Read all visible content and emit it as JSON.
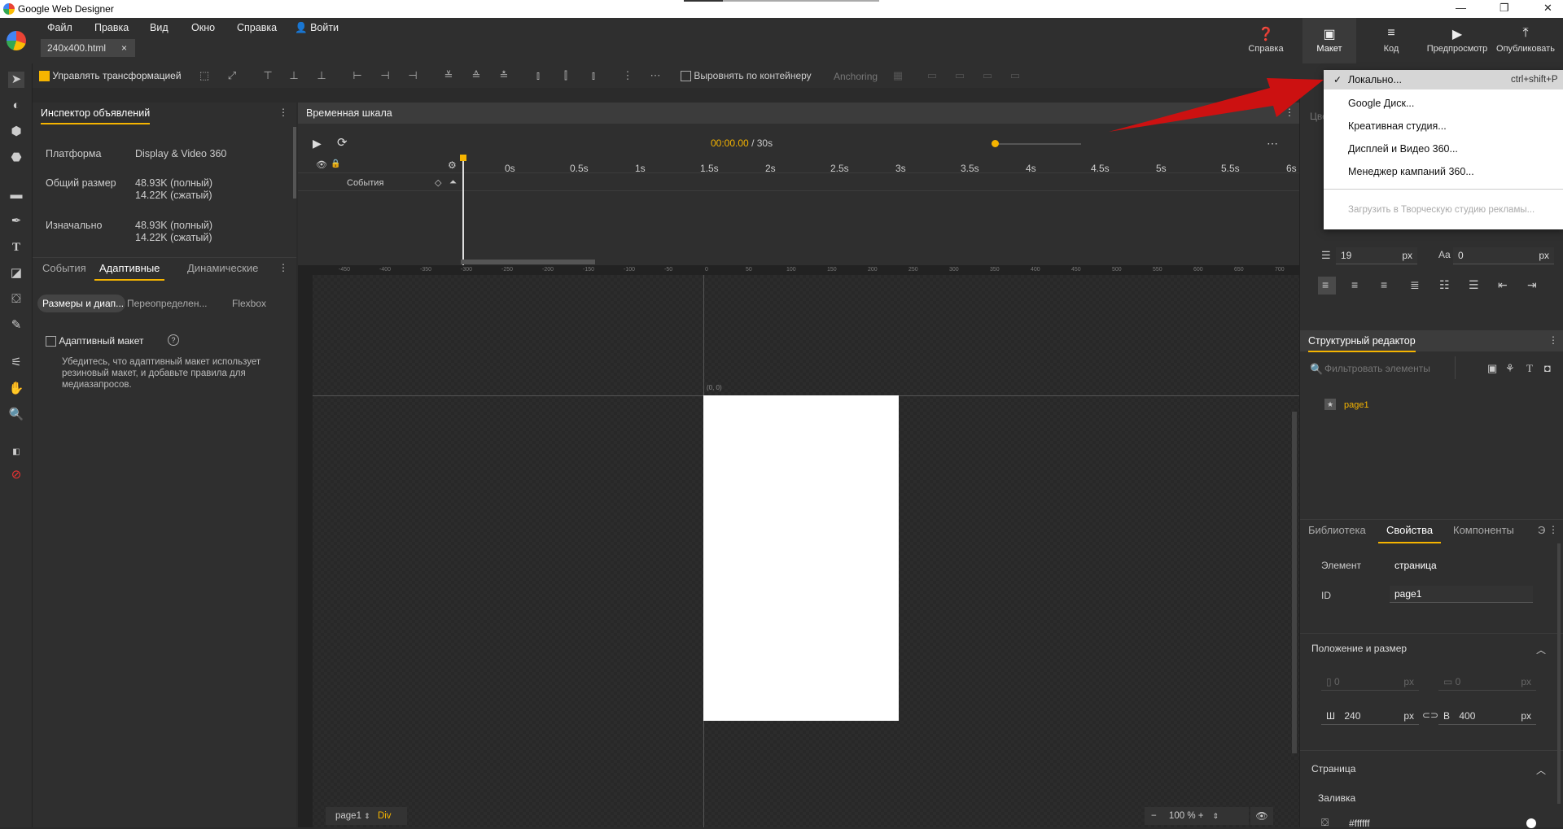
{
  "window": {
    "title": "Google Web Designer"
  },
  "menu": {
    "file": "Файл",
    "edit": "Правка",
    "view": "Вид",
    "window": "Окно",
    "help": "Справка",
    "signin": "Войти"
  },
  "file_tab": {
    "name": "240x400.html",
    "close": "×"
  },
  "top_buttons": {
    "help": "Справка",
    "layout": "Макет",
    "code": "Код",
    "preview": "Предпросмотр",
    "publish": "Опубликовать"
  },
  "toolbar": {
    "manage_transform": "Управлять трансформацией",
    "align_container": "Выровнять по контейнеру",
    "anchoring": "Anchoring"
  },
  "inspector": {
    "title": "Инспектор объявлений",
    "platform_label": "Платформа",
    "platform_value": "Display & Video 360",
    "total_label": "Общий размер",
    "total_full": "48.93K (полный)",
    "total_compressed": "14.22K (сжатый)",
    "initial_label": "Изначально",
    "initial_full": "48.93K (полный)",
    "initial_compressed": "14.22K (сжатый)",
    "tabs": [
      "События",
      "Адаптивные",
      "Динамические"
    ],
    "subtabs": [
      "Размеры и диап...",
      "Переопределен...",
      "Flexbox"
    ],
    "adaptive_label": "Адаптивный макет",
    "adaptive_help": "Убедитесь, что адаптивный макет использует резиновый макет, и добавьте правила для медиазапросов."
  },
  "timeline": {
    "title": "Временная шкала",
    "current_time": "00:00.00",
    "total": "/ 30s",
    "events_label": "События",
    "ticks": [
      "0s",
      "0.5s",
      "1s",
      "1.5s",
      "2s",
      "2.5s",
      "3s",
      "3.5s",
      "4s",
      "4.5s",
      "5s",
      "5.5s",
      "6s"
    ]
  },
  "canvas": {
    "origin": "(0, 0)",
    "page_selector": "page1",
    "element_type": "Div",
    "zoom": "100",
    "zoom_unit": "%",
    "ruler_top": [
      "-450",
      "-400",
      "-350",
      "-300",
      "-250",
      "-200",
      "-150",
      "-100",
      "-50",
      "0",
      "50",
      "100",
      "150",
      "200",
      "250",
      "300",
      "350",
      "400",
      "450",
      "500",
      "550",
      "600",
      "650",
      "700"
    ]
  },
  "dropdown": {
    "items": [
      "Локально...",
      "Google Диск...",
      "Креативная студия...",
      "Дисплей и Видео 360...",
      "Менеджер кампаний 360..."
    ],
    "shortcut": "ctrl+shift+P",
    "disabled": "Загрузить в Творческую студию рекламы...",
    "check": "✓"
  },
  "right_panel": {
    "color_stub": "Цвет",
    "line_height": "19",
    "letter_spacing": "0",
    "unit": "px",
    "structure_title": "Структурный редактор",
    "filter_placeholder": "Фильтровать элементы",
    "tree_item": "page1",
    "tabs": [
      "Библиотека",
      "Свойства",
      "Компоненты",
      "Э"
    ],
    "element_label": "Элемент",
    "element_value": "страница",
    "id_label": "ID",
    "id_value": "page1",
    "pos_title": "Положение и размер",
    "x": "0",
    "y": "0",
    "w_label": "Ш",
    "w": "240",
    "h_label": "В",
    "h": "400",
    "page_title": "Страница",
    "fill_label": "Заливка",
    "fill_value": "#ffffff"
  },
  "colors": {
    "accent": "#f5b400",
    "arrow": "#cc1111"
  }
}
